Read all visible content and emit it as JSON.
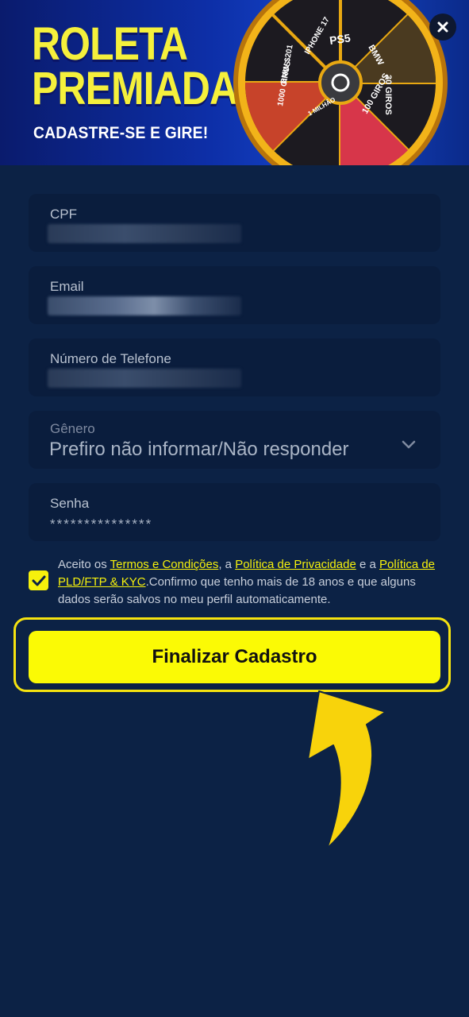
{
  "banner": {
    "title_line1": "ROLETA",
    "title_line2": "PREMIADA",
    "subtitle": "CADASTRE-SE E GIRE!",
    "wheel_labels": [
      "PS5",
      "BMW",
      "30 GIROS",
      "100 GIROS",
      "1 MILHÃO",
      "1000 GIROS",
      "BMW $201",
      "IPHONE 17"
    ]
  },
  "form": {
    "cpf_label": "CPF",
    "email_label": "Email",
    "phone_label": "Número de Telefone",
    "gender_label": "Gênero",
    "gender_value": "Prefiro não informar/Não responder",
    "password_label": "Senha",
    "password_value": "***************"
  },
  "terms": {
    "prefix": "Aceito os ",
    "link_terms": "Termos e Condições",
    "sep1": ", a ",
    "link_privacy": "Política de Privacidade",
    "sep2": " e a ",
    "link_pld": "Política de PLD/FTP & KYC",
    "suffix": ".Confirmo que tenho mais de 18 anos e que alguns dados serão salvos no meu perfil automaticamente.",
    "checked": true
  },
  "cta": {
    "label": "Finalizar Cadastro"
  },
  "colors": {
    "background": "#0c2245",
    "field": "#0a1d3d",
    "accent": "#fbfa05"
  }
}
